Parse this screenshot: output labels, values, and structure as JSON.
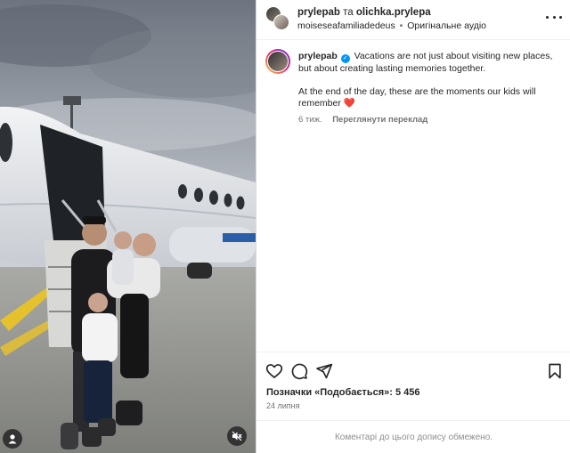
{
  "post": {
    "header": {
      "author": "prylepab",
      "connector": "та",
      "coauthor": "olichka.prylepa",
      "audio_user": "moiseseafamiliadedeus",
      "audio_sep": "•",
      "audio_label": "Оригінальне аудіо"
    },
    "caption": {
      "username": "prylepab",
      "verified_mark": "✓",
      "line1": "Vacations are not just about visiting new places, but about creating lasting memories together.",
      "line2": "At the end of the day, these are the moments our kids will remember",
      "emoji": "❤️",
      "time_ago": "6 тиж.",
      "translate_label": "Переглянути переклад"
    },
    "likes_text": "Позначки «Подобається»: 5 456",
    "date": "24 липня",
    "comments_limited": "Коментарі до цього допису обмежено."
  },
  "icons": {
    "photo_user_tag": "user-tag-icon",
    "photo_mute": "volume-muted-icon",
    "more": "more-options-icon",
    "like": "heart-icon",
    "comment": "comment-icon",
    "share": "share-icon",
    "save": "bookmark-icon"
  },
  "colors": {
    "verified": "#0095f6",
    "text": "#262626",
    "secondary": "#737373",
    "border": "#dbdbdb",
    "heart_emoji": "#e0245e"
  }
}
